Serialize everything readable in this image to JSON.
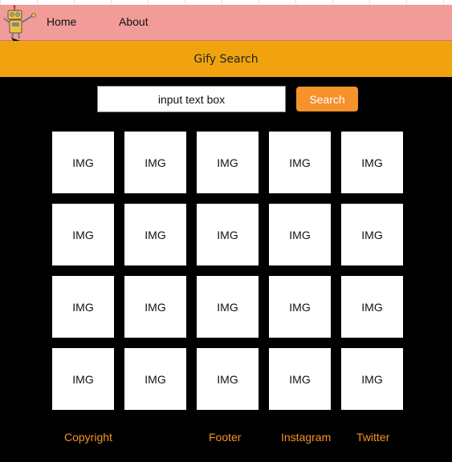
{
  "nav": {
    "home_label": "Home",
    "about_label": "About"
  },
  "banner": {
    "title": "Gify Search"
  },
  "search": {
    "placeholder": "input text box",
    "button_label": "Search"
  },
  "grid": {
    "tiles": [
      "IMG",
      "IMG",
      "IMG",
      "IMG",
      "IMG",
      "IMG",
      "IMG",
      "IMG",
      "IMG",
      "IMG",
      "IMG",
      "IMG",
      "IMG",
      "IMG",
      "IMG",
      "IMG",
      "IMG",
      "IMG",
      "IMG",
      "IMG"
    ]
  },
  "footer": {
    "copyright": "Copyright",
    "footer": "Footer",
    "instagram": "Instagram",
    "twitter": "Twitter"
  },
  "colors": {
    "navbar_bg": "#f19c99",
    "banner_bg": "#f0a30e",
    "page_bg": "#000000",
    "accent": "#f5922b"
  },
  "icons": {
    "logo": "robot-icon"
  }
}
